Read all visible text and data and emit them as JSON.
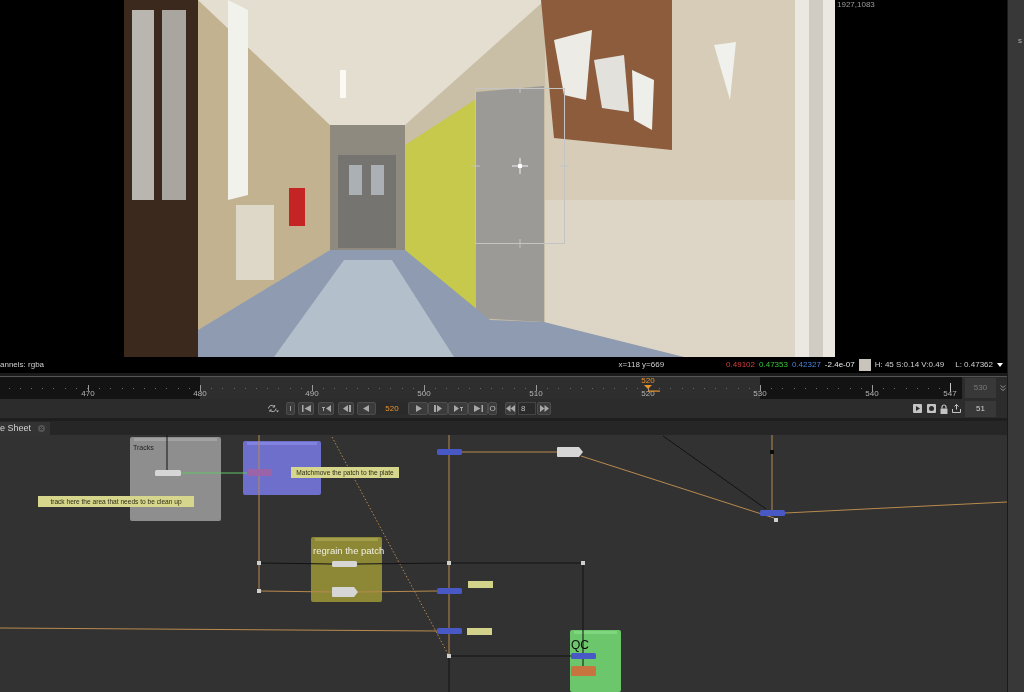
{
  "viewer": {
    "format_label": "1927,1083",
    "info_bar": {
      "channels": "annels: rgba",
      "coordinates": "x=118 y=669",
      "values": [
        {
          "text": "0.49102",
          "kind": "red"
        },
        {
          "text": "0.47353",
          "kind": "green"
        },
        {
          "text": "0.42327",
          "kind": "blue"
        },
        {
          "text": "-2.4e-07",
          "kind": "alpha"
        }
      ],
      "swatch": {
        "color": "#c8c4bc"
      },
      "hsv": "H: 45 S:0.14 V:0.49",
      "luminance": "L: 0.47362"
    }
  },
  "timeline": {
    "ticks": [
      {
        "label": "470",
        "in_range": false,
        "playhead": false
      },
      {
        "label": "480",
        "in_range": true,
        "playhead": false
      },
      {
        "label": "490",
        "in_range": true,
        "playhead": false
      },
      {
        "label": "500",
        "in_range": true,
        "playhead": false
      },
      {
        "label": "510",
        "in_range": true,
        "playhead": false
      },
      {
        "label": "520",
        "in_range": true,
        "playhead": true
      },
      {
        "label": "530",
        "in_range": false,
        "playhead": false
      },
      {
        "label": "540",
        "in_range": false,
        "playhead": false
      }
    ],
    "last_frame": "547",
    "playhead_label": "520",
    "end_frame": "530",
    "transport": {
      "in_label": "I",
      "frame": "520",
      "out_label": "O",
      "step": "8"
    },
    "fps": "51"
  },
  "tabs": [
    {
      "label": "e Sheet",
      "selected": true
    }
  ],
  "node_graph": {
    "backdrops": [
      {
        "label": "Tracks",
        "color": "#8e8e8e"
      },
      {
        "color": "#6e6ecb"
      },
      {
        "label": "regrain the patch",
        "color": "#8c8836"
      },
      {
        "label": "QC",
        "color": "#6cc66c"
      }
    ],
    "sticky_notes": [
      {
        "text": "track here the area that needs to be clean up"
      },
      {
        "text": "Matchmove the patch to the plate"
      }
    ],
    "nodes": [
      {
        "kind": "node",
        "color": "#d6d6d6"
      },
      {
        "kind": "node",
        "color": "#9c64a8"
      },
      {
        "kind": "node",
        "color": "#4858c4"
      },
      {
        "kind": "shaped",
        "color": "#d6d6d6"
      },
      {
        "kind": "node",
        "color": "#4858c4"
      },
      {
        "kind": "node",
        "color": "#d6d6d6"
      },
      {
        "kind": "shaped",
        "color": "#d6d6d6"
      },
      {
        "kind": "node",
        "color": "#4858c4"
      },
      {
        "kind": "node",
        "color": "#4858c4"
      },
      {
        "kind": "node",
        "color": "#4858c4"
      },
      {
        "kind": "node",
        "color": "#c8743e"
      },
      {
        "kind": "note",
        "color": "#d2d28a"
      },
      {
        "kind": "note",
        "color": "#d2d28a"
      }
    ]
  },
  "properties_panel": {
    "text": "s"
  }
}
